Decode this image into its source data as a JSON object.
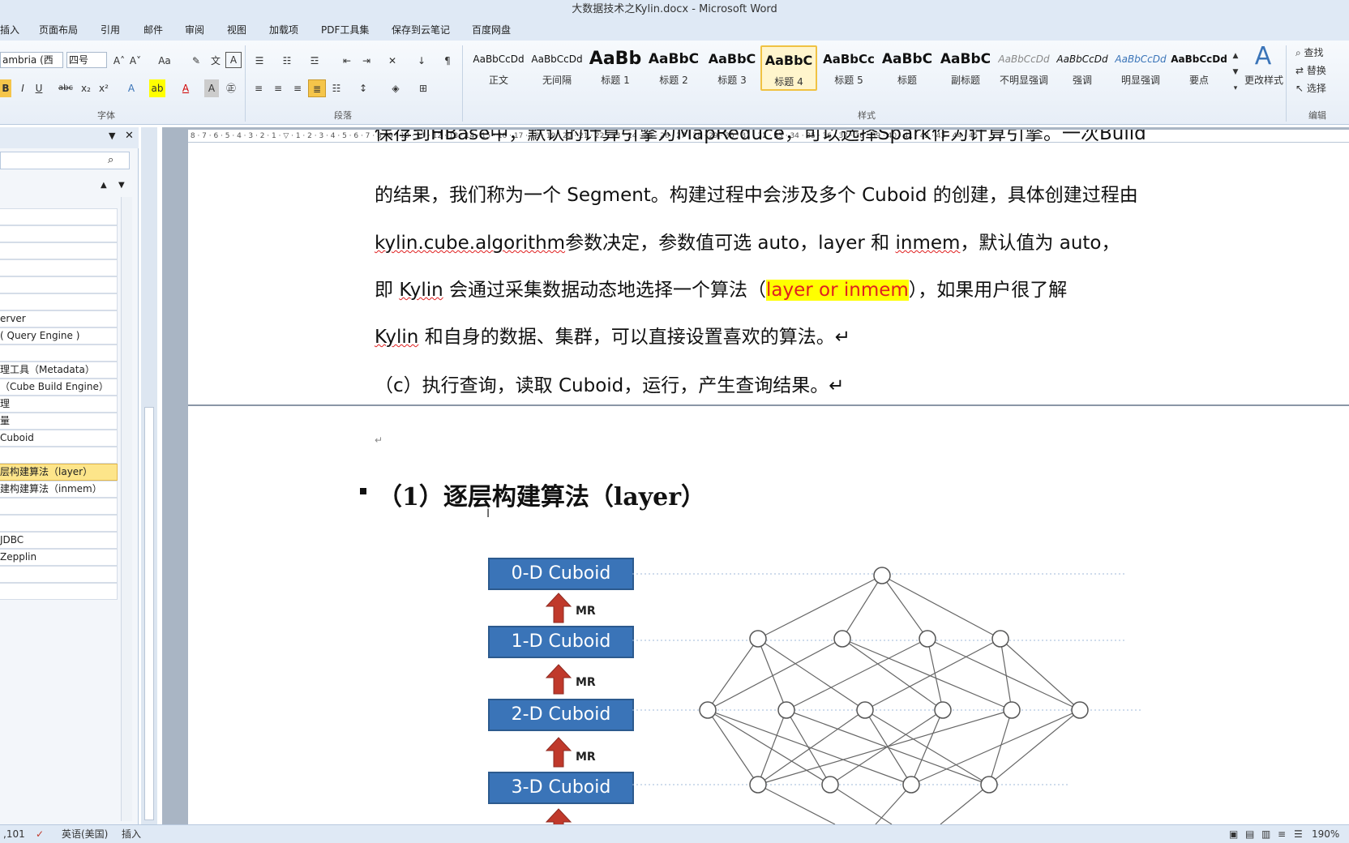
{
  "window": {
    "title": "大数据技术之Kylin.docx - Microsoft Word"
  },
  "menu": {
    "tabs": [
      "插入",
      "页面布局",
      "引用",
      "邮件",
      "审阅",
      "视图",
      "加载项",
      "PDF工具集",
      "保存到云笔记",
      "百度网盘"
    ]
  },
  "ribbon": {
    "font": {
      "font_name": "ambria (西",
      "font_size": "四号",
      "group_label": "字体"
    },
    "paragraph": {
      "group_label": "段落"
    },
    "styles": {
      "group_label": "样式",
      "items": [
        {
          "sample": "AaBbCcDd",
          "name": "正文"
        },
        {
          "sample": "AaBbCcDd",
          "name": "无间隔"
        },
        {
          "sample": "AaBb",
          "name": "标题 1"
        },
        {
          "sample": "AaBbC",
          "name": "标题 2"
        },
        {
          "sample": "AaBbC",
          "name": "标题 3"
        },
        {
          "sample": "AaBbC",
          "name": "标题 4"
        },
        {
          "sample": "AaBbCc",
          "name": "标题 5"
        },
        {
          "sample": "AaBbC",
          "name": "标题"
        },
        {
          "sample": "AaBbC",
          "name": "副标题"
        },
        {
          "sample": "AaBbCcDd",
          "name": "不明显强调"
        },
        {
          "sample": "AaBbCcDd",
          "name": "强调"
        },
        {
          "sample": "AaBbCcDd",
          "name": "明显强调"
        },
        {
          "sample": "AaBbCcDd",
          "name": "要点"
        }
      ],
      "change_styles": "更改样式"
    },
    "editing": {
      "find": "查找",
      "replace": "替换",
      "select": "选择",
      "group_label": "编辑"
    }
  },
  "navpane": {
    "items": [
      "",
      "",
      "",
      "",
      "",
      "",
      "erver",
      "( Query Engine )",
      "",
      "理工具（Metadata）",
      "（Cube Build Engine）",
      "理",
      "量",
      "Cuboid",
      "",
      "层构建算法（layer）",
      "建构建算法（inmem）",
      "",
      "",
      "JDBC",
      "Zepplin",
      "",
      ""
    ],
    "active_index": 15
  },
  "document": {
    "para_top_partial": "保存到HBase中，默认的计算引擎为MapReduce，可以选择Spark作为计算引擎。一次Build",
    "para1": "的结果，我们称为一个 Segment。构建过程中会涉及多个 Cuboid 的创建，具体创建过程由",
    "para2_a": "kylin.cube.algorithm",
    "para2_b": "参数决定，参数值可选 auto，layer 和 ",
    "para2_c": "inmem",
    "para2_d": "，默认值为 auto，",
    "para3_a": "即 ",
    "para3_b": "Kylin",
    "para3_c": " 会通过采集数据动态地选择一个算法（",
    "para3_highlight": "layer or inmem",
    "para3_d": "），如果用户很了解",
    "para4_a": "Kylin",
    "para4_b": " 和自身的数据、集群，可以直接设置喜欢的算法。↵",
    "para5": "（c）执行查询，读取 Cuboid，运行，产生查询结果。↵",
    "heading": "（1）逐层构建算法（layer）"
  },
  "diagram": {
    "levels": [
      "0-D Cuboid",
      "1-D Cuboid",
      "2-D Cuboid",
      "3-D Cuboid"
    ],
    "mr_label": "MR"
  },
  "statusbar": {
    "page_info": ",101",
    "language": "英语(美国)",
    "mode": "插入",
    "zoom": "190%"
  }
}
